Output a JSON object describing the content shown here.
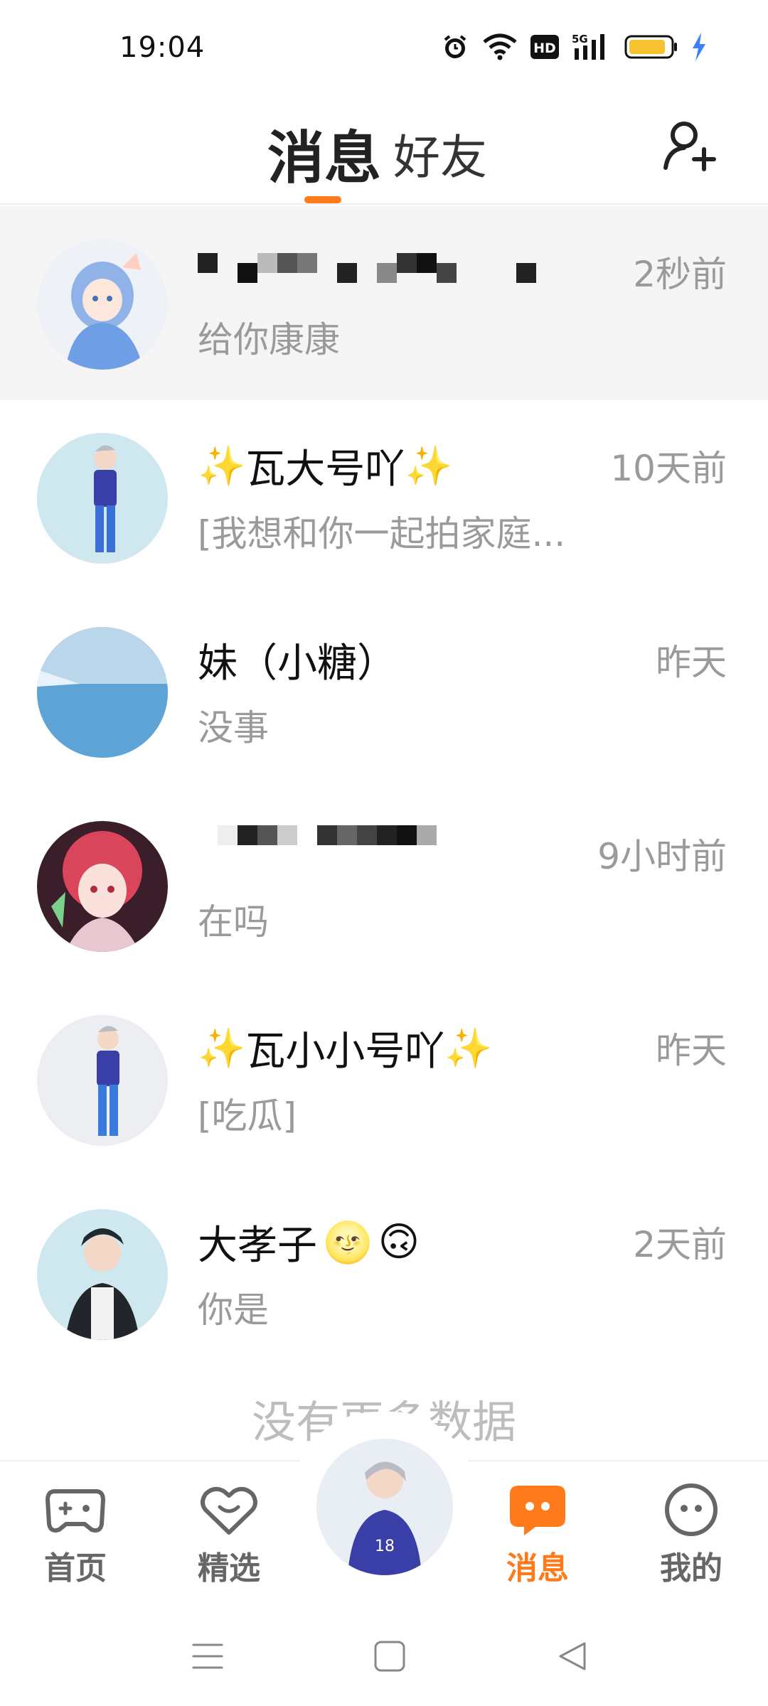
{
  "status_bar": {
    "time": "19:04",
    "icons": [
      "alarm-icon",
      "wifi-icon",
      "hd-icon",
      "5g-signal-icon",
      "battery-icon",
      "charging-icon"
    ],
    "network_label": "5G",
    "hd_label": "HD"
  },
  "header": {
    "tabs": [
      {
        "label": "消息",
        "active": true
      },
      {
        "label": "好友",
        "active": false
      }
    ],
    "add_friend_icon": "add-person-icon",
    "accent_color": "#ff7a1a"
  },
  "conversations": [
    {
      "name": "",
      "name_redacted": true,
      "time": "2秒前",
      "preview": "给你康康",
      "highlighted": true
    },
    {
      "name": "瓦大号吖",
      "sparkles": true,
      "time": "10天前",
      "preview": "[我想和你一起拍家庭..."
    },
    {
      "name": "妹（小糖）",
      "time": "昨天",
      "preview": "没事"
    },
    {
      "name": "",
      "name_redacted": true,
      "time": "9小时前",
      "preview": "在吗"
    },
    {
      "name": "瓦小小号吖",
      "sparkles": true,
      "time": "昨天",
      "preview": "[吃瓜]"
    },
    {
      "name": "大孝子",
      "emoji": [
        "🌝",
        "🙃"
      ],
      "time": "2天前",
      "preview": "你是"
    }
  ],
  "list_footer": "没有更多数据",
  "bottom_nav": {
    "items": [
      {
        "label": "首页",
        "icon": "gamepad-icon",
        "active": false
      },
      {
        "label": "精选",
        "icon": "heart-chat-icon",
        "active": false
      },
      {
        "label": "消息",
        "icon": "chat-bubble-icon",
        "active": true
      },
      {
        "label": "我的",
        "icon": "smiley-face-icon",
        "active": false
      }
    ]
  },
  "system_nav": [
    "menu-icon",
    "home-square-icon",
    "back-triangle-icon"
  ]
}
